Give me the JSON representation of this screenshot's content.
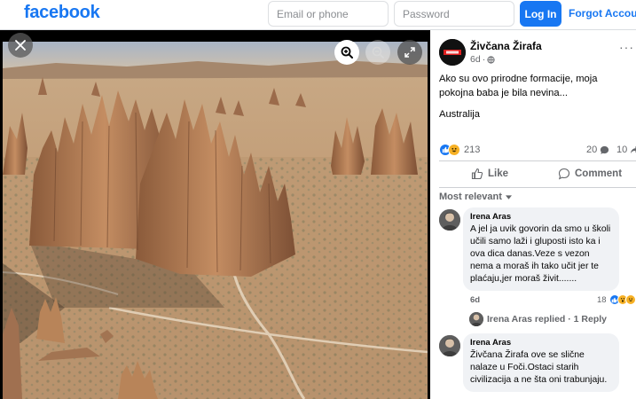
{
  "header": {
    "logo": "facebook",
    "email_placeholder": "Email or phone",
    "password_placeholder": "Password",
    "login_label": "Log In",
    "forgot_label": "Forgot Account?"
  },
  "viewer": {
    "icons": [
      "close-icon",
      "zoom-in-icon",
      "zoom-out-icon",
      "fullscreen-icon"
    ]
  },
  "post": {
    "page_name": "Živčana Žirafa",
    "time": "6d",
    "audience_icon": "globe-icon",
    "text": "Ako su ovo prirodne formacije, moja pokojna baba je bila nevina...",
    "location": "Australija",
    "reactions_count": "213",
    "comments_count": "20",
    "shares_count": "10",
    "like_label": "Like",
    "comment_label": "Comment"
  },
  "comments_sort": "Most relevant",
  "comments": [
    {
      "author": "Irena Aras",
      "text": "A jel ja uvik govorin da smo u školi učili samo laži i gluposti isto ka i ova dica danas.Veze s vezon nema a moraš ih tako učit jer te plaćaju,jer moraš živit.......",
      "time": "6d",
      "reactions": "18",
      "replies_label": "Irena Aras replied · 1 Reply"
    },
    {
      "author": "Irena Aras",
      "text": "Živčana Žirafa ove se slične nalaze u Foči.Ostaci starih civilizacija a ne šta oni trabunjaju."
    }
  ],
  "colors": {
    "brand": "#1877f2",
    "like": "#1877f2",
    "haha": "#f7b125"
  }
}
